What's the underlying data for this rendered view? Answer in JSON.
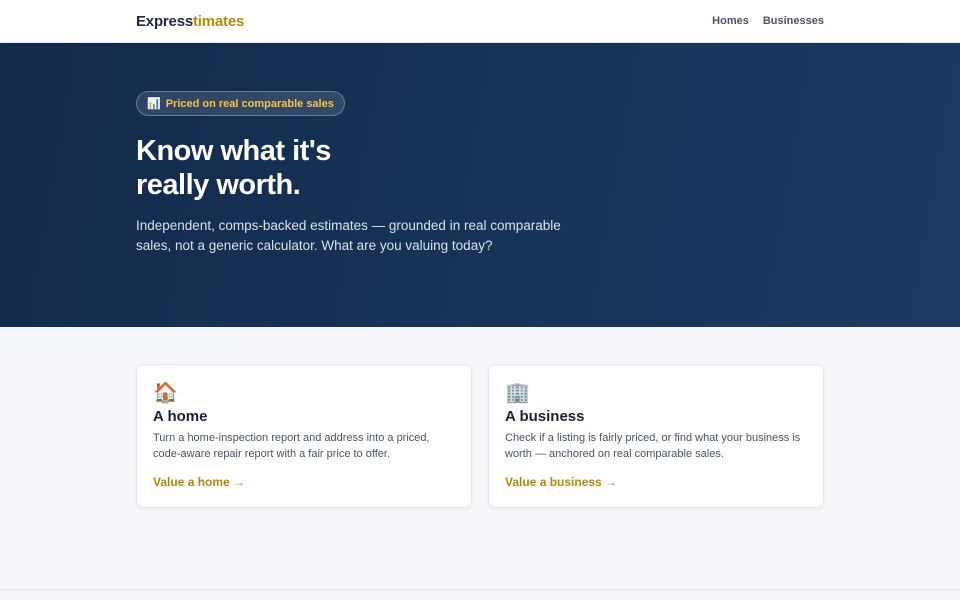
{
  "header": {
    "logo_main": "Express",
    "logo_accent": "timates",
    "nav": [
      {
        "label": "Homes"
      },
      {
        "label": "Businesses"
      }
    ]
  },
  "hero": {
    "badge_icon": "📊",
    "badge_text": "Priced on real comparable sales",
    "headline": "Know what it's really worth.",
    "subtext": "Independent, comps-backed estimates — grounded in real comparable sales, not a generic calculator. What are you valuing today?"
  },
  "cards": [
    {
      "icon": "🏠",
      "title": "A home",
      "description": "Turn a home-inspection report and address into a priced, code-aware repair report with a fair price to offer.",
      "link": "Value a home →"
    },
    {
      "icon": "🏢",
      "title": "A business",
      "description": "Check if a listing is fairly priced, or find what your business is worth — anchored on real comparable sales.",
      "link": "Value a business →"
    }
  ],
  "colors": {
    "brand_navy": "#13294a",
    "accent_gold": "#b8860b",
    "badge_yellow": "#f6c343"
  }
}
